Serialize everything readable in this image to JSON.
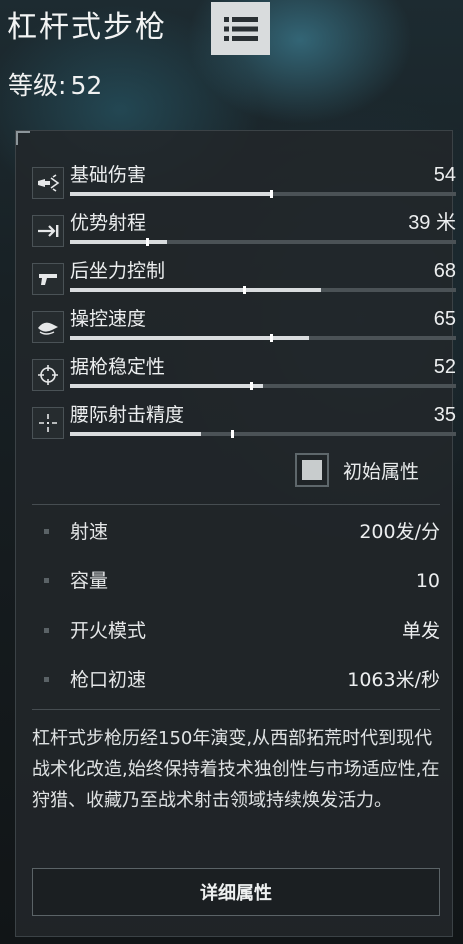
{
  "header": {
    "title": "杠杆式步枪",
    "level_label": "等级:",
    "level_value": "52"
  },
  "stats": [
    {
      "label": "基础伤害",
      "value": "54",
      "icon": "bullet-damage-icon",
      "fill": 0.52,
      "marker": 0.52
    },
    {
      "label": "优势射程",
      "value": "39 米",
      "icon": "range-arrow-icon",
      "fill": 0.25,
      "marker": 0.2
    },
    {
      "label": "后坐力控制",
      "value": "68",
      "icon": "pistol-recoil-icon",
      "fill": 0.65,
      "marker": 0.45
    },
    {
      "label": "操控速度",
      "value": "65",
      "icon": "handling-icon",
      "fill": 0.62,
      "marker": 0.52
    },
    {
      "label": "据枪稳定性",
      "value": "52",
      "icon": "crosshair-circle-icon",
      "fill": 0.5,
      "marker": 0.47
    },
    {
      "label": "腰际射击精度",
      "value": "35",
      "icon": "hipfire-crosshair-icon",
      "fill": 0.34,
      "marker": 0.42
    }
  ],
  "toggle": {
    "label": "初始属性",
    "checked": true
  },
  "specs": [
    {
      "label": "射速",
      "value": "200发/分"
    },
    {
      "label": "容量",
      "value": "10"
    },
    {
      "label": "开火模式",
      "value": "单发"
    },
    {
      "label": "枪口初速",
      "value": "1063米/秒"
    }
  ],
  "description": "杠杆式步枪历经150年演变,从西部拓荒时代到现代战术化改造,始终保持着技术独创性与市场适应性,在狩猎、收藏乃至战术射击领域持续焕发活力。",
  "detail_button": "详细属性",
  "colors": {
    "panel_bg": "#22272a",
    "bar_track": "#4b5256",
    "bar_fill": "#d9dcde",
    "menu_button": "#d9dcdd"
  }
}
